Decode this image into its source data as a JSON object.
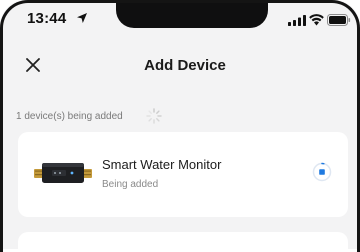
{
  "status_bar": {
    "time": "13:44",
    "location_icon": "location-arrow-icon",
    "signal_icon": "cellular-signal-icon",
    "wifi_icon": "wifi-icon",
    "battery_icon": "battery-icon"
  },
  "nav": {
    "close_icon": "close-icon",
    "title": "Add Device"
  },
  "progress": {
    "label": "1 device(s) being added",
    "spinner_icon": "loading-spinner-icon"
  },
  "device": {
    "name": "Smart Water Monitor",
    "status": "Being added",
    "action_icon": "stop-icon"
  },
  "colors": {
    "background": "#f3f3f4",
    "card": "#ffffff",
    "accent": "#1f7ae0"
  }
}
